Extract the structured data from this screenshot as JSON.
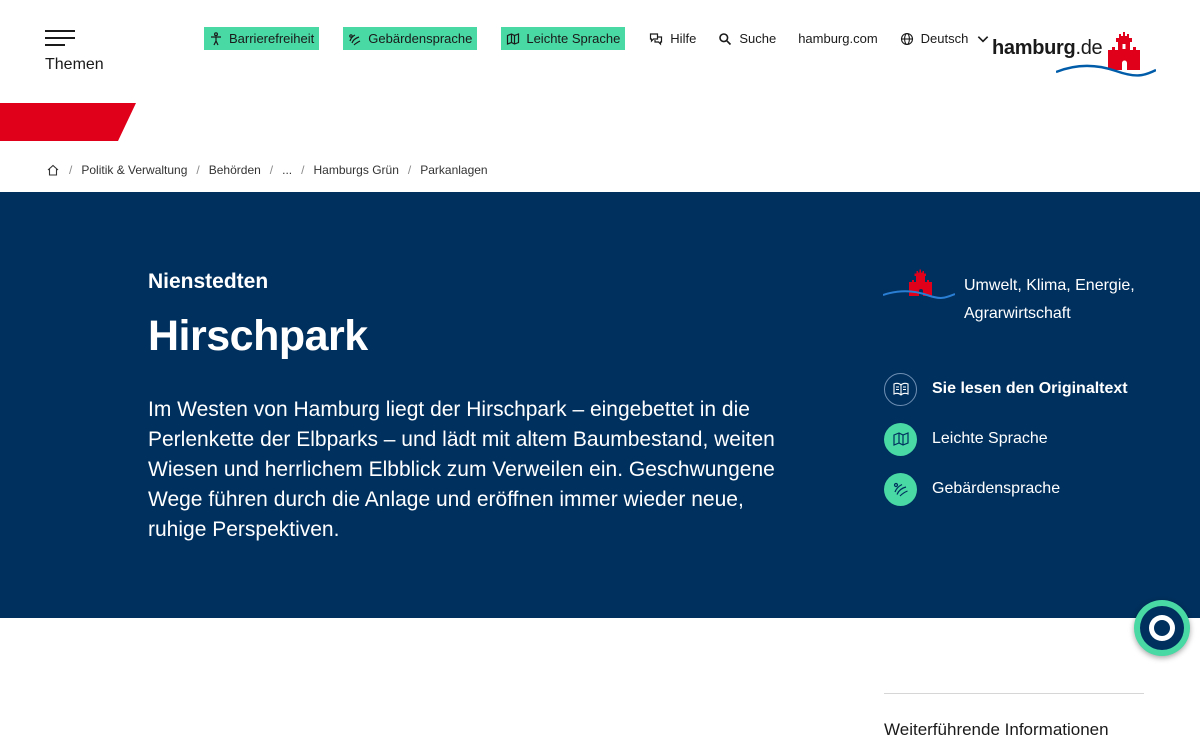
{
  "header": {
    "menu_label": "Themen",
    "chips": [
      {
        "label": "Barrierefreiheit",
        "icon": "accessibility-icon"
      },
      {
        "label": "Gebärdensprache",
        "icon": "sign-language-icon"
      },
      {
        "label": "Leichte Sprache",
        "icon": "easy-language-icon"
      }
    ],
    "links": [
      {
        "label": "Hilfe",
        "icon": "help-chat-icon"
      },
      {
        "label": "Suche",
        "icon": "search-icon"
      },
      {
        "label": "hamburg.com"
      },
      {
        "label": "Deutsch",
        "icon": "globe-icon"
      }
    ],
    "logo": {
      "word": "hamburg",
      "tld": ".de"
    }
  },
  "breadcrumb": [
    "Politik & Verwaltung",
    "Behörden",
    "...",
    "Hamburgs Grün",
    "Parkanlagen"
  ],
  "hero": {
    "kicker": "Nienstedten",
    "title": "Hirschpark",
    "lead": "Im Westen von Hamburg liegt der Hirschpark – eingebettet in die Perlenkette der Elbparks – und lädt mit altem Baumbestand, weiten Wiesen und herrlichem Elbblick zum Verweilen ein. Geschwungene Wege führen durch die Anlage und eröffnen immer wieder neue, ruhige Perspektiven.",
    "authority": "Umwelt, Klima, Energie, Agrarwirtschaft",
    "options": [
      {
        "label": "Sie lesen den Originaltext",
        "icon": "book-icon",
        "active": true
      },
      {
        "label": "Leichte Sprache",
        "icon": "easy-language-icon",
        "active": false
      },
      {
        "label": "Gebärdensprache",
        "icon": "sign-language-icon",
        "active": false
      }
    ]
  },
  "sidebar": {
    "heading": "Weiterführende Informationen"
  },
  "colors": {
    "navy": "#00305e",
    "mint": "#48d9a4",
    "red": "#e10019",
    "wave": "#005ca9"
  }
}
